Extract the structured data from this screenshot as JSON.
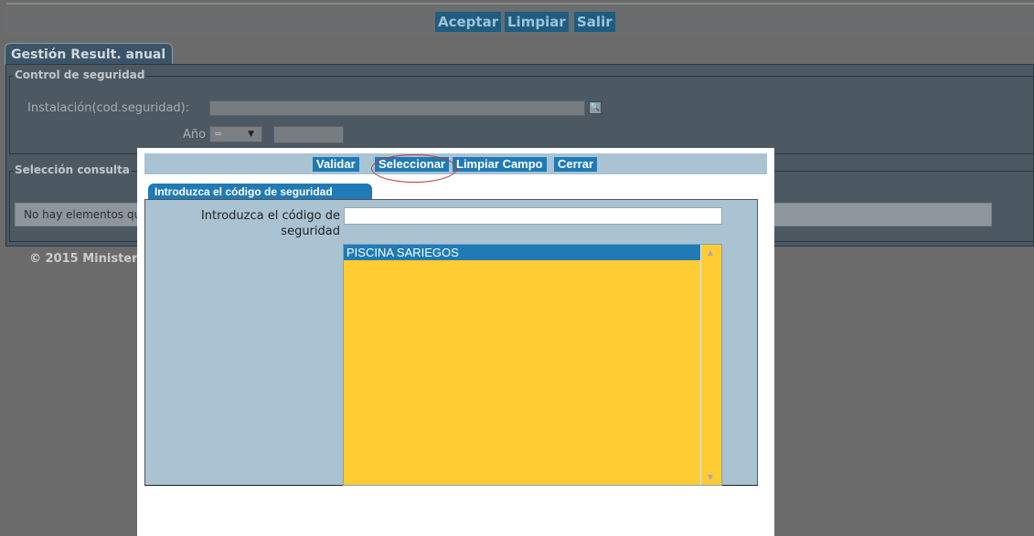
{
  "toolbar": {
    "accept_label": "Aceptar",
    "clear_label": "Limpiar",
    "exit_label": "Salir"
  },
  "background": {
    "tab_label": "Gestión Result. anual",
    "security_legend": "Control de seguridad",
    "installation_label": "Instalación(cod.seguridad):",
    "year_label": "Año",
    "year_operator": "=",
    "query_legend": "Selección consulta",
    "no_elements_message": "No hay elementos que",
    "footer": "© 2015 Minister"
  },
  "modal": {
    "buttons": {
      "validate": "Validar",
      "select": "Seleccionar",
      "clear_field": "Limpiar Campo",
      "close": "Cerrar"
    },
    "tab_label": "Introduzca el código de seguridad",
    "field_label": "Introduzca el código de seguridad",
    "field_value": "",
    "list_items": [
      "PISCINA SARIEGOS"
    ]
  },
  "colors": {
    "modal_button": "#1f7ab6",
    "modal_panel": "#a9c3d3",
    "list_background": "#ffcc33",
    "highlight_ellipse": "#c53333"
  }
}
